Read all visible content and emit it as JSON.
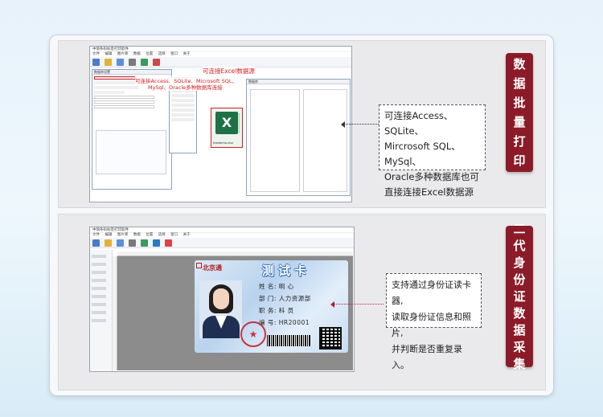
{
  "section1": {
    "vertical_label": [
      "数",
      "据",
      "批",
      "量",
      "打",
      "印"
    ],
    "callout_lines": [
      "可连接Access、SQLite、",
      "Mircrosoft SQL、MySql、",
      "Oracle多种数据库也可",
      "直接连接Excel数据源"
    ],
    "screenshot": {
      "note_excel": "可连接Excel数据源",
      "note_db_1": "可连接Access、SQLite、Microsoft SQL、",
      "note_db_2": "MySql、Oracle多种数据库连接",
      "excel_file_label": "testdemo.xlsx",
      "menu_items": [
        "文件",
        "编辑",
        "图片库",
        "数据",
        "位置",
        "选择",
        "窗口",
        "关于"
      ]
    }
  },
  "section2": {
    "vertical_label": [
      "二",
      "代",
      "身",
      "份",
      "证",
      "数",
      "据",
      "采",
      "集"
    ],
    "callout_lines": [
      "支持通过身份证读卡器,",
      "读取身份证信息和照片,",
      "并判断是否重复录入。"
    ],
    "card": {
      "logo": "北京通",
      "title": "测试卡",
      "name_line": "姓 名: 明 心",
      "dept_line": "部 门: 人力资源部",
      "role_line": "职 务: 科 员",
      "id_line": "编 号: HR20001"
    }
  },
  "colors": {
    "label_bg": "#8b1b28",
    "red_note": "#d62020",
    "excel_green": "#1e7145"
  }
}
